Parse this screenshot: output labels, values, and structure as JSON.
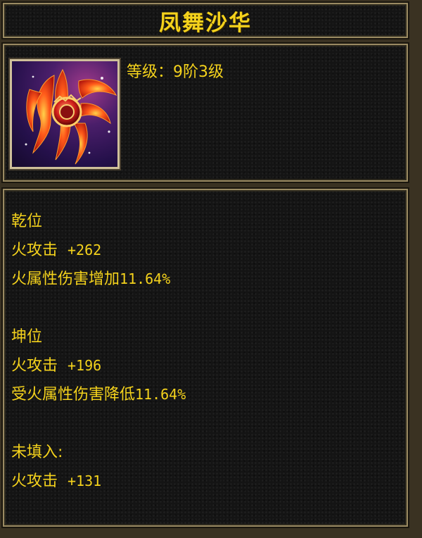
{
  "item": {
    "name": "凤舞沙华",
    "level_text": "等级：9阶3级",
    "icon": "phoenix-feather-icon"
  },
  "sections": [
    {
      "heading": "乾位",
      "stats": [
        {
          "name": "火攻击",
          "value": "+262"
        },
        {
          "name": "火属性伤害增加",
          "value": "11.64%"
        }
      ]
    },
    {
      "heading": "坤位",
      "stats": [
        {
          "name": "火攻击",
          "value": "+196"
        },
        {
          "name": "受火属性伤害降低",
          "value": "11.64%"
        }
      ]
    },
    {
      "heading": "未填入:",
      "stats": [
        {
          "name": "火攻击",
          "value": "+131"
        }
      ]
    }
  ],
  "colors": {
    "text": "#f4d21c",
    "border": "#9a8a62",
    "panel": "#141414"
  }
}
